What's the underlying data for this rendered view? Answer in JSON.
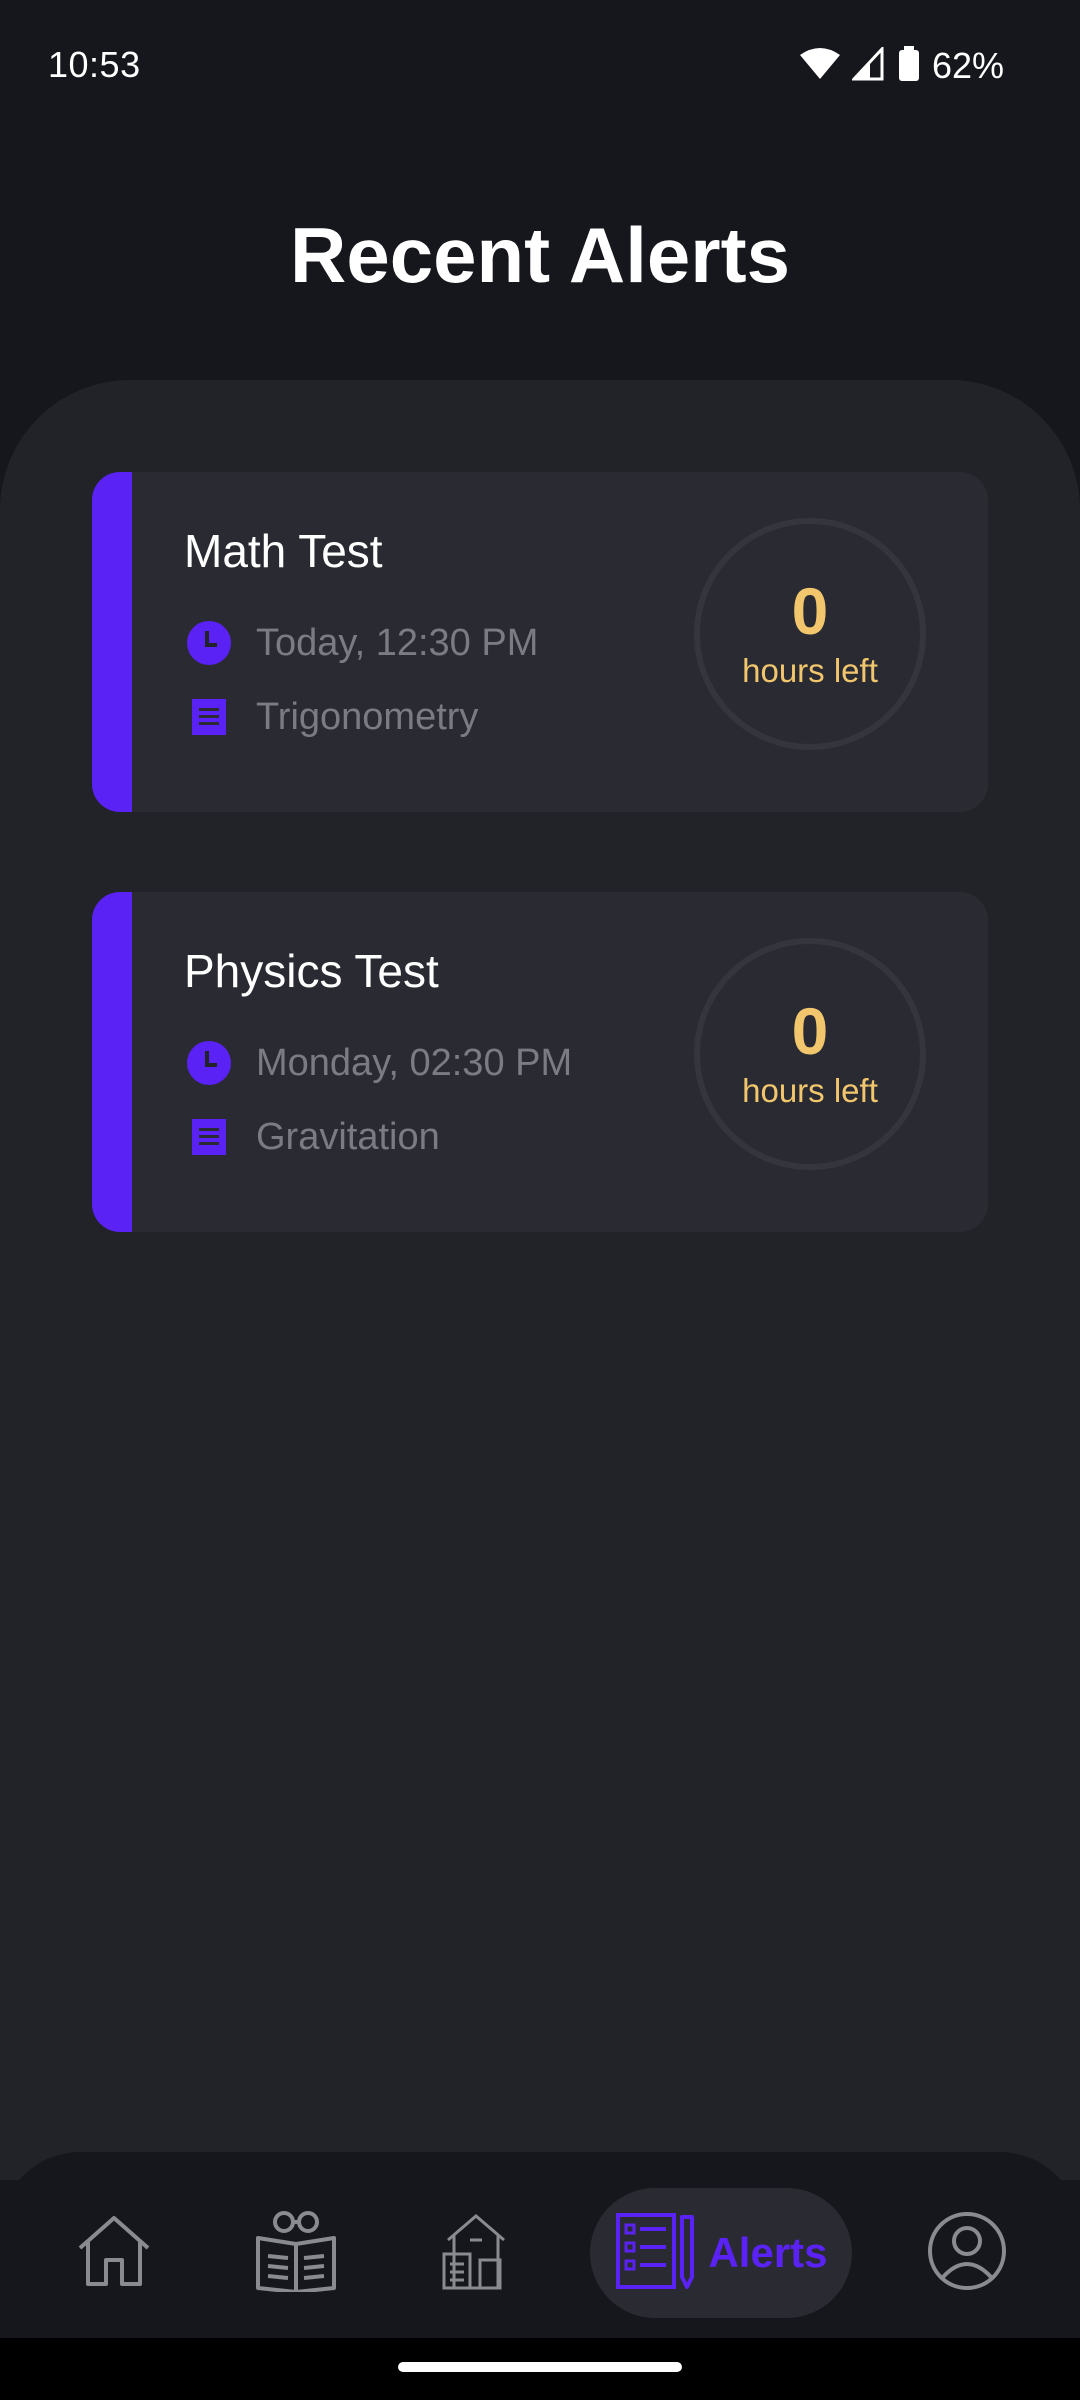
{
  "status_bar": {
    "time": "10:53",
    "battery": "62%"
  },
  "header": {
    "title": "Recent Alerts"
  },
  "alerts": [
    {
      "title": "Math Test",
      "time": "Today, 12:30 PM",
      "topic": "Trigonometry",
      "hours_value": "0",
      "hours_label": "hours left"
    },
    {
      "title": "Physics Test",
      "time": "Monday, 02:30 PM",
      "topic": "Gravitation",
      "hours_value": "0",
      "hours_label": "hours left"
    }
  ],
  "nav": {
    "items": [
      "home-icon",
      "library-icon",
      "school-icon",
      "alerts-icon",
      "profile-icon"
    ],
    "active_label": "Alerts"
  },
  "colors": {
    "accent": "#5b22f5",
    "highlight": "#f2c66d",
    "background": "#15171c",
    "panel": "#222329",
    "card": "#2a2b32"
  }
}
